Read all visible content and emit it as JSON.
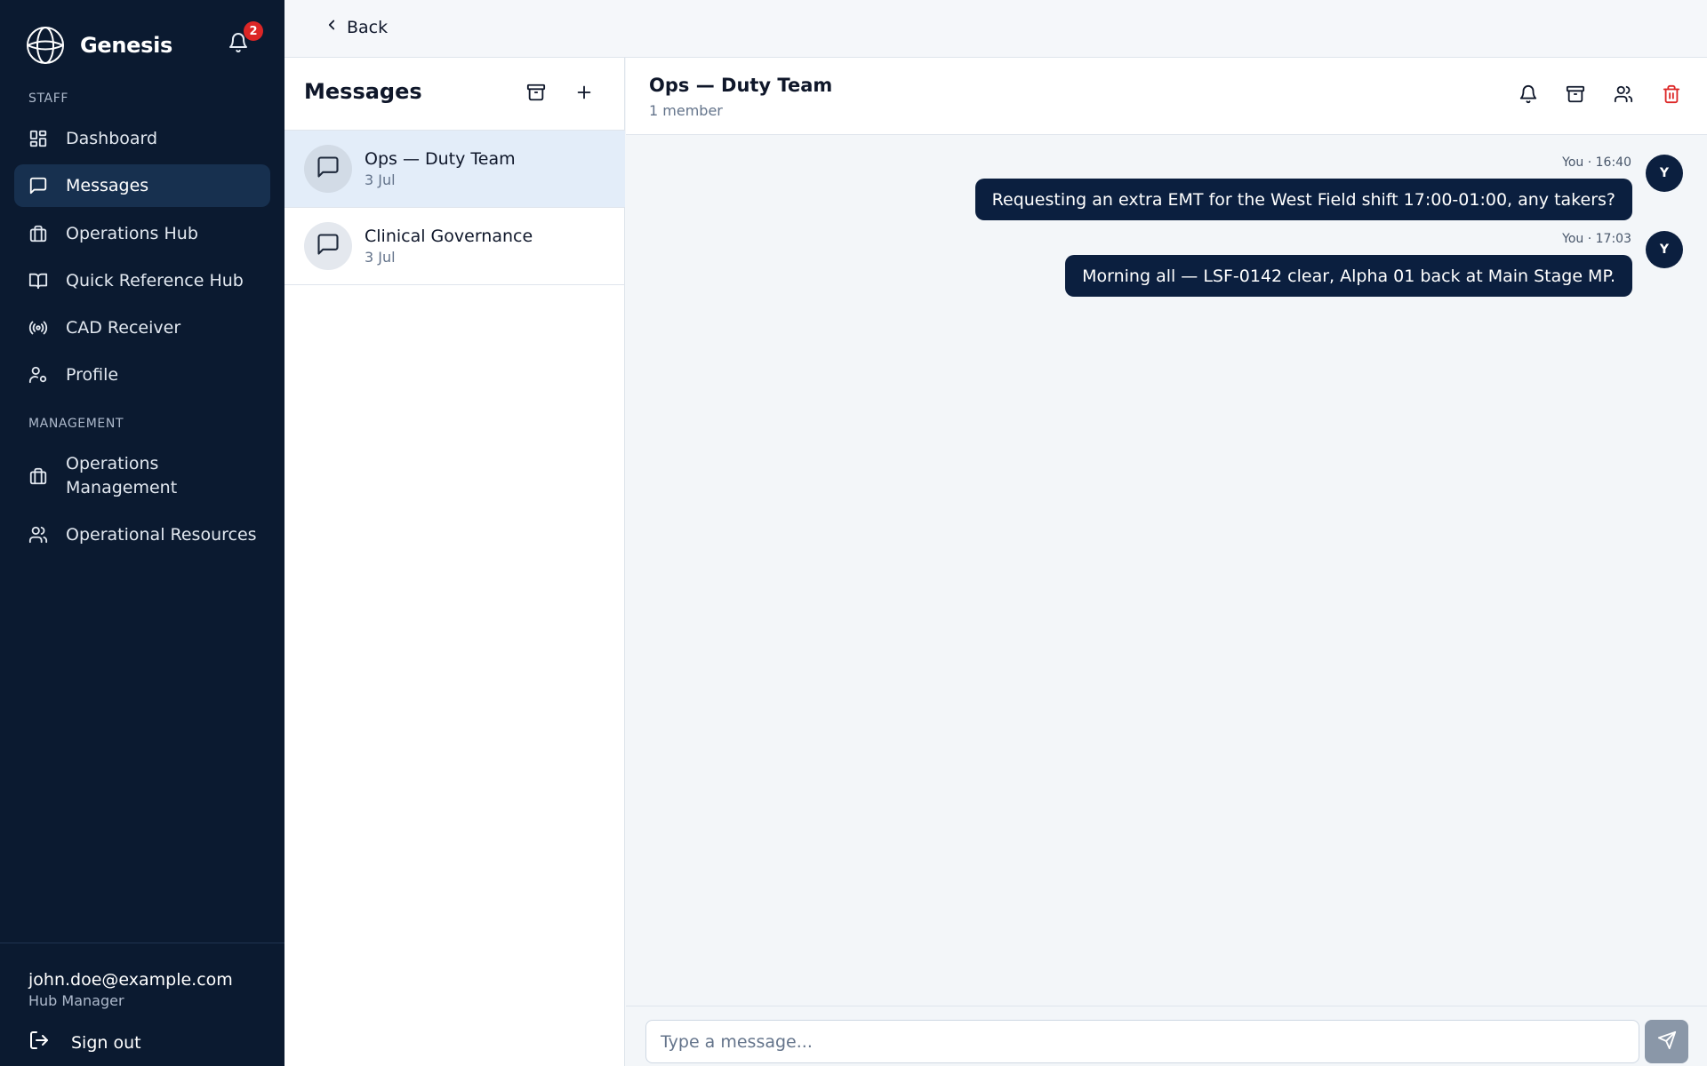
{
  "brand": {
    "name": "Genesis",
    "logo_icon": "globe-logo-icon"
  },
  "notifications": {
    "count": "2",
    "icon": "bell-icon"
  },
  "sidebar": {
    "sections": [
      {
        "label": "STAFF"
      },
      {
        "label": "MANAGEMENT"
      }
    ],
    "items": [
      {
        "label": "Dashboard",
        "icon": "dashboard-icon"
      },
      {
        "label": "Messages",
        "icon": "message-icon",
        "active": true
      },
      {
        "label": "Operations Hub",
        "icon": "briefcase-icon"
      },
      {
        "label": "Quick Reference Hub",
        "icon": "book-icon"
      },
      {
        "label": "CAD Receiver",
        "icon": "broadcast-icon"
      },
      {
        "label": "Profile",
        "icon": "user-gear-icon"
      },
      {
        "label": "Operations",
        "label2": "Management",
        "icon": "briefcase-icon"
      },
      {
        "label": "Operational Resources",
        "icon": "users-icon"
      }
    ]
  },
  "user": {
    "email": "john.doe@example.com",
    "role": "Hub Manager",
    "signout_label": "Sign out"
  },
  "topbar": {
    "back_label": "Back"
  },
  "messages_panel": {
    "title": "Messages",
    "conversations": [
      {
        "name": "Ops — Duty Team",
        "date": "3 Jul",
        "active": true
      },
      {
        "name": "Clinical Governance",
        "date": "3 Jul",
        "active": false
      }
    ]
  },
  "chat": {
    "title": "Ops — Duty Team",
    "subtitle": "1 member",
    "messages": [
      {
        "meta": "You · 16:40",
        "text": "Requesting an extra EMT for the West Field shift 17:00-01:00, any takers?",
        "avatar": "Y"
      },
      {
        "meta": "You · 17:03",
        "text": "Morning all — LSF-0142 clear, Alpha 01 back at Main Stage MP.",
        "avatar": "Y"
      }
    ],
    "composer_placeholder": "Type a message..."
  },
  "colors": {
    "sidebar_bg": "#0b1a30",
    "bubble_bg": "#0b1f3f",
    "badge": "#dc2626",
    "danger": "#dc2626",
    "active_conv": "#e3edf9"
  }
}
